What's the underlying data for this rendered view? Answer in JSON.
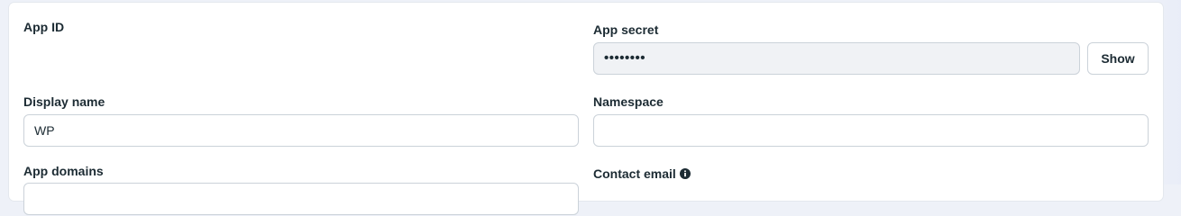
{
  "settings": {
    "app_id": {
      "label": "App ID",
      "value": ""
    },
    "app_secret": {
      "label": "App secret",
      "value": "••••••••",
      "show_button": "Show"
    },
    "display_name": {
      "label": "Display name",
      "value": "WP"
    },
    "namespace": {
      "label": "Namespace",
      "value": ""
    },
    "app_domains": {
      "label": "App domains",
      "value": ""
    },
    "contact_email": {
      "label": "Contact email",
      "icon": "info-circle-icon"
    }
  },
  "colors": {
    "text": "#1c2b33",
    "border": "#cbd2d9",
    "readonly_background": "#f0f2f5",
    "page_background": "#eef1f8"
  }
}
